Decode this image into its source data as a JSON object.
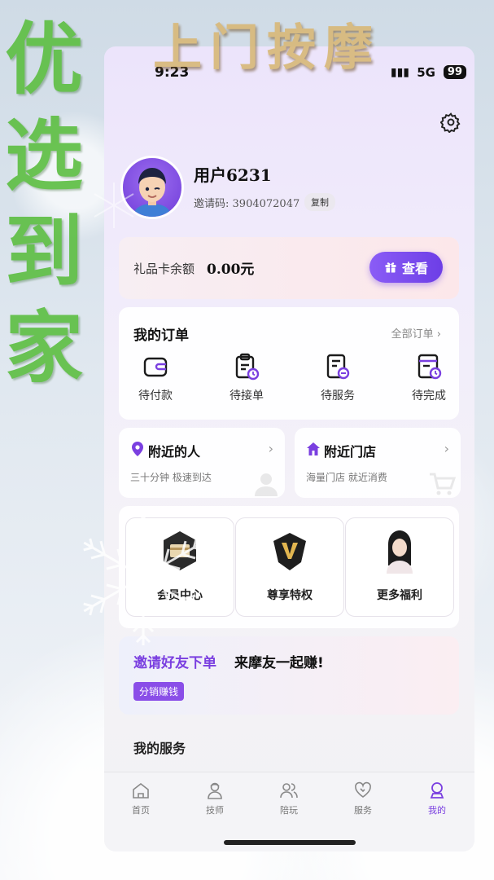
{
  "status_bar": {
    "time": "9:23",
    "network": "5G",
    "battery": "99"
  },
  "profile": {
    "username": "用户6231",
    "invite_label": "邀请码:",
    "invite_code": "3904072047",
    "copy_label": "复制"
  },
  "gift_card": {
    "label": "礼品卡余额",
    "amount": "0.00元",
    "button_label": "查看"
  },
  "orders": {
    "title": "我的订单",
    "all_label": "全部订单",
    "items": [
      {
        "label": "待付款",
        "icon": "wallet-icon"
      },
      {
        "label": "待接单",
        "icon": "clipboard-clock-icon"
      },
      {
        "label": "待服务",
        "icon": "document-minus-icon"
      },
      {
        "label": "待完成",
        "icon": "document-clock-icon"
      }
    ]
  },
  "nearby": [
    {
      "title": "附近的人",
      "subtitle": "三十分钟 极速到达",
      "icon": "location-pin-icon"
    },
    {
      "title": "附近门店",
      "subtitle": "海量门店 就近消费",
      "icon": "home-icon"
    }
  ],
  "perks": [
    {
      "label": "会员中心",
      "icon": "member-card-icon"
    },
    {
      "label": "尊享特权",
      "icon": "v-badge-icon"
    },
    {
      "label": "更多福利",
      "icon": "model-photo-icon"
    }
  ],
  "promo": {
    "highlight": "邀请好友下单",
    "text": "来摩友一起赚!",
    "tag": "分销赚钱"
  },
  "services_title": "我的服务",
  "tabbar": {
    "items": [
      {
        "label": "首页",
        "icon": "home-outline-icon",
        "active": false
      },
      {
        "label": "技师",
        "icon": "technician-icon",
        "active": false
      },
      {
        "label": "陪玩",
        "icon": "people-icon",
        "active": false
      },
      {
        "label": "服务",
        "icon": "heart-icon",
        "active": false
      },
      {
        "label": "我的",
        "icon": "user-icon",
        "active": true
      }
    ]
  },
  "watermark": {
    "title": "上门按摩",
    "side": "优选到家"
  },
  "colors": {
    "accent": "#7a3fe0",
    "button": "#6d3ee6",
    "watermark_green": "#5fbf45",
    "watermark_gold": "#d8b97a"
  }
}
